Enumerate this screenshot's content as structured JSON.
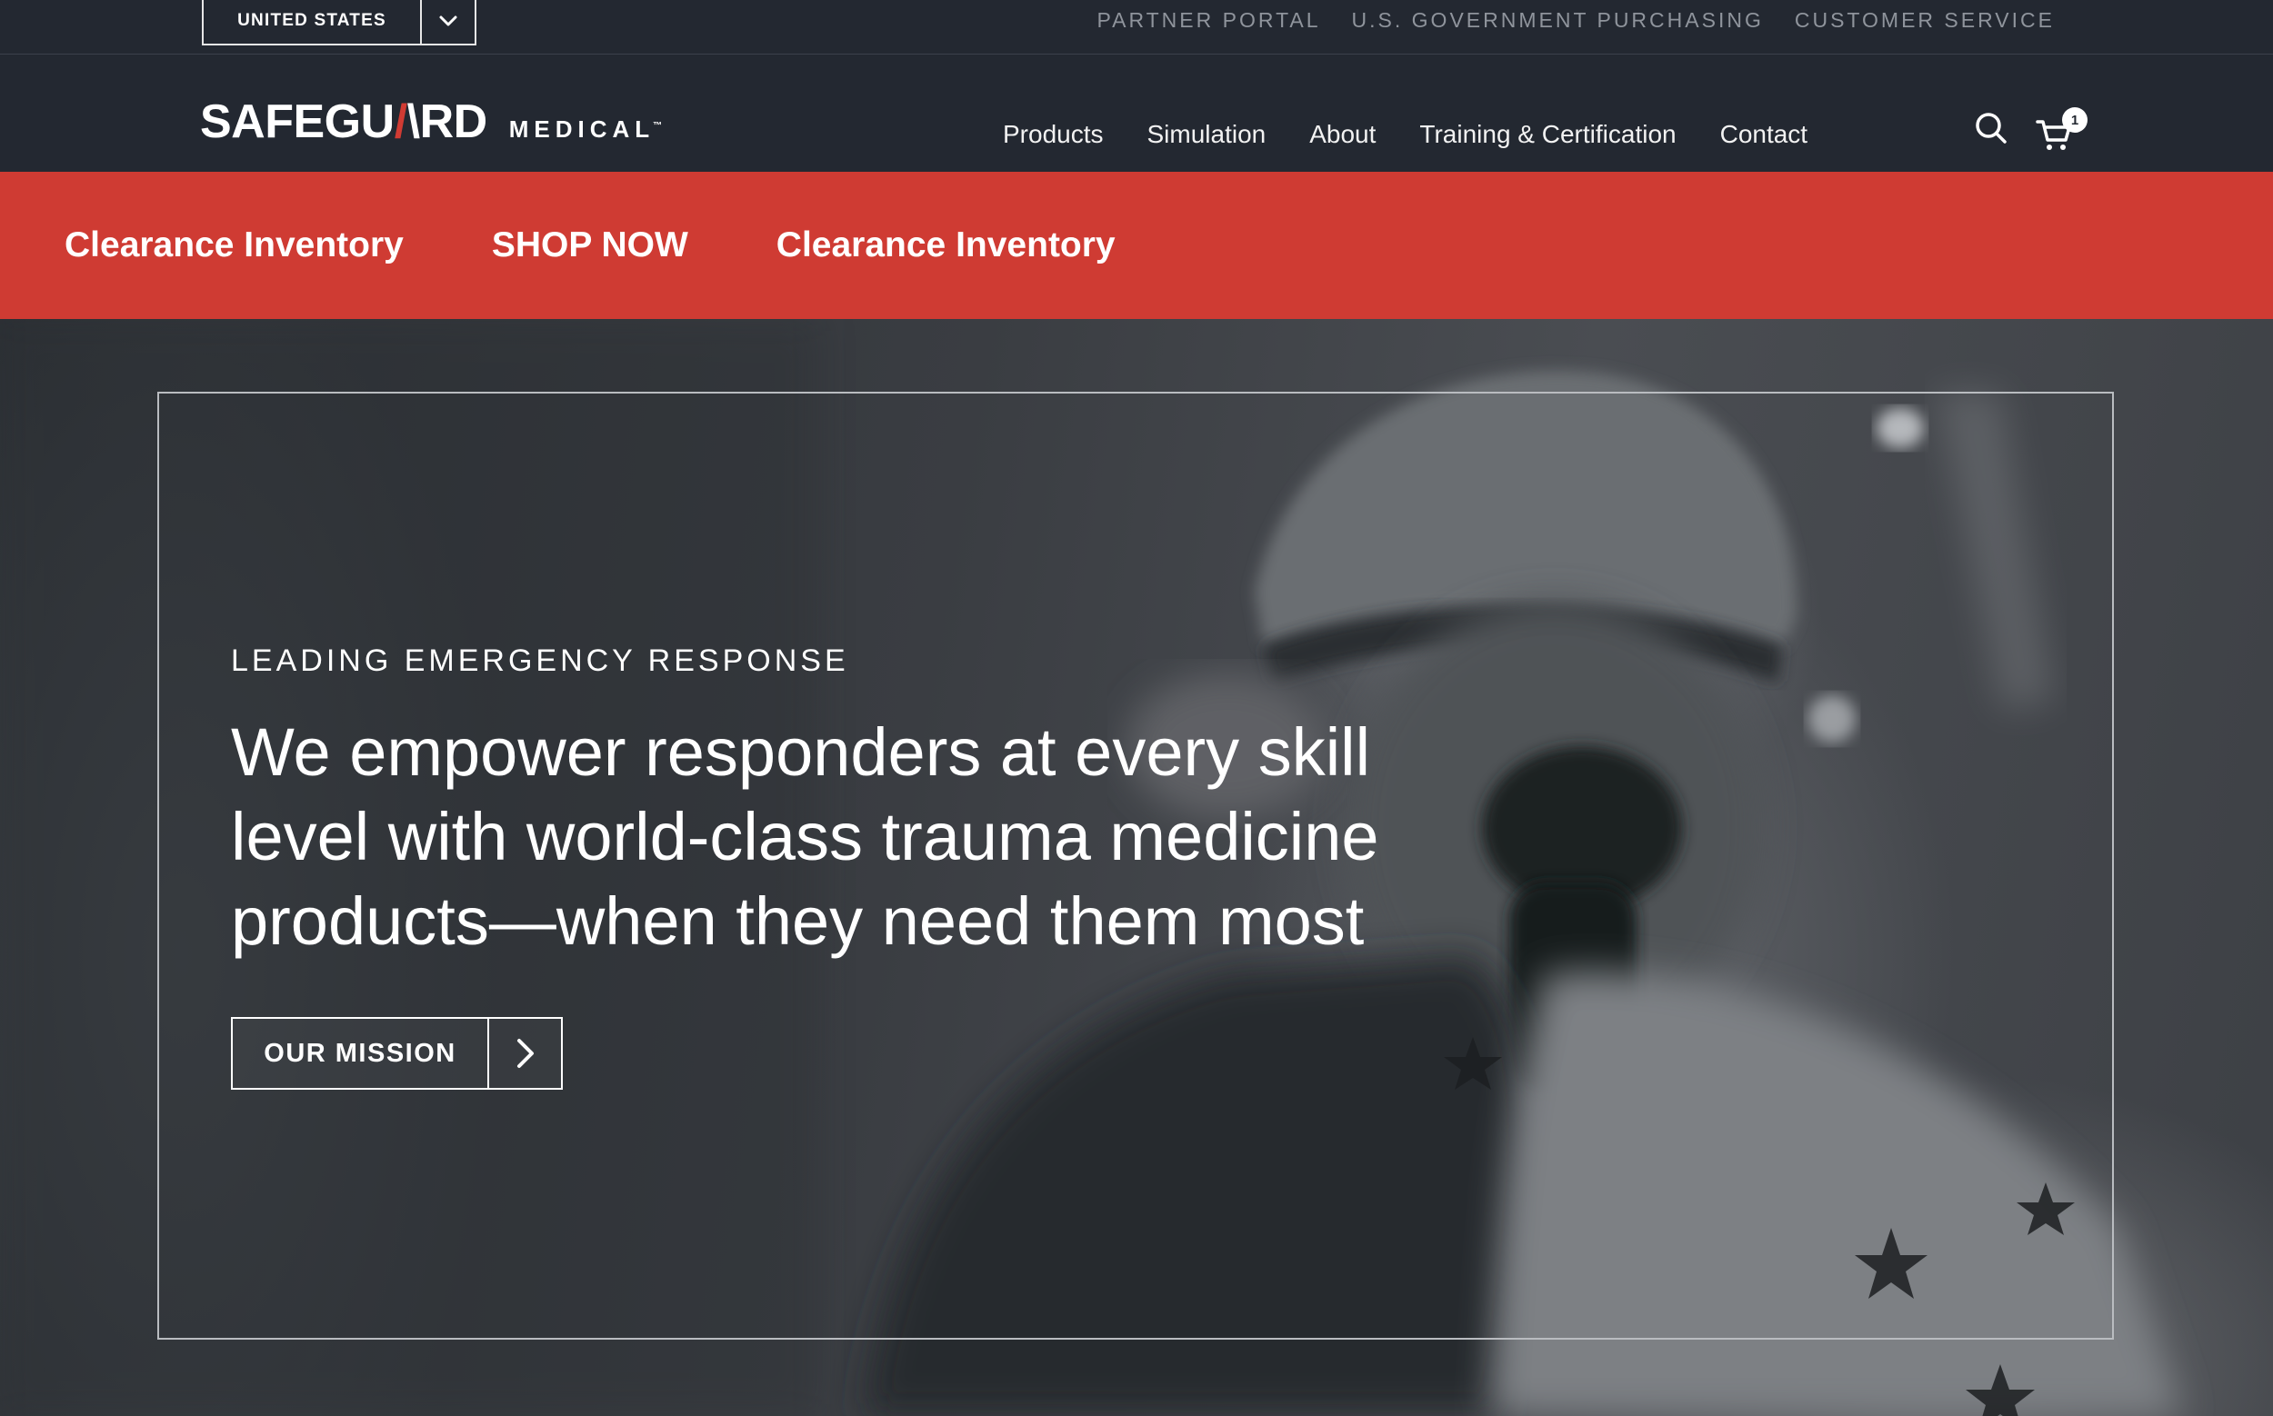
{
  "utility_bar": {
    "country": "UNITED STATES",
    "links": [
      "PARTNER PORTAL",
      "U.S. GOVERNMENT PURCHASING",
      "CUSTOMER SERVICE"
    ]
  },
  "header": {
    "logo": {
      "word_left": "SAFEGU",
      "word_slash": "/",
      "word_right": "\\RD",
      "sub": "MEDICAL",
      "tm": "™"
    },
    "nav": [
      "Products",
      "Simulation",
      "About",
      "Training & Certification",
      "Contact"
    ],
    "cart_count": "1",
    "icons": [
      "search-icon",
      "cart-icon",
      "chevron-down-icon"
    ]
  },
  "promo": {
    "items": [
      "Clearance Inventory",
      "SHOP NOW",
      "Clearance Inventory"
    ]
  },
  "hero": {
    "eyebrow": "LEADING EMERGENCY RESPONSE",
    "headline": "We empower responders at every skill level with world-class trauma medicine products—when they need them most",
    "button_label": "OUR MISSION"
  },
  "colors": {
    "header_bg": "#232831",
    "accent_red": "#cf3b33",
    "utility_text": "#8f949c"
  }
}
